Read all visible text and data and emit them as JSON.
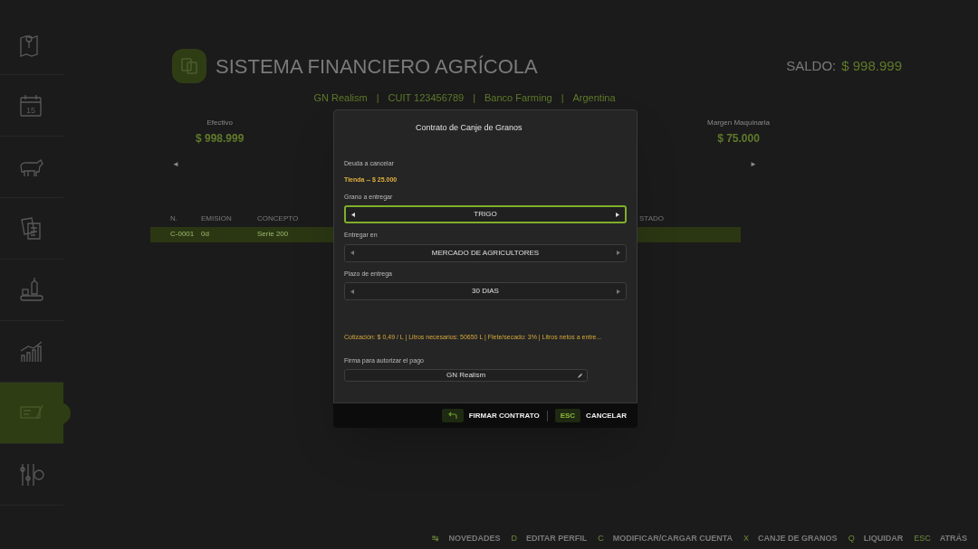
{
  "sidebar": {
    "items": [
      {
        "selected": false
      },
      {
        "text": "15",
        "selected": false
      },
      {
        "selected": false
      },
      {
        "selected": false
      },
      {
        "selected": false
      },
      {
        "selected": false
      },
      {
        "selected": true
      },
      {
        "selected": false
      }
    ]
  },
  "header": {
    "title": "SISTEMA FINANCIERO AGRÍCOLA",
    "balance_label": "SALDO:",
    "balance": "$ 998.999",
    "info": [
      "GN Realism",
      "CUIT 123456789",
      "Banco Farming",
      "Argentina"
    ],
    "separator": "|"
  },
  "stats": [
    {
      "label": "Efectivo",
      "value": "$ 998.999"
    },
    {
      "label": "Margen Maquinaria",
      "value": "$ 75.000"
    }
  ],
  "carousel": {
    "prev": "◄",
    "next": "►"
  },
  "table": {
    "columns": [
      "N.",
      "EMISION",
      "CONCEPTO",
      "STADO"
    ],
    "rows": [
      {
        "cells": [
          "C-0001",
          "0d",
          "Serie 200"
        ],
        "selected": true
      }
    ]
  },
  "dialog": {
    "title": "Contrato de Canje de Granos",
    "debt_label": "Deuda a cancelar",
    "debt": "Tienda -- $ 25.000",
    "selectors": [
      {
        "label": "Grano a entregar",
        "value": "TRIGO",
        "focused": true
      },
      {
        "label": "Entregar en",
        "value": "MERCADO DE AGRICULTORES",
        "focused": false
      },
      {
        "label": "Plazo de entrega",
        "value": "30 DIAS",
        "focused": false
      }
    ],
    "summary": "Cotización: $ 0,49 / L | Litros necesarios: 50650 L | Flete/secado: 3% | Litros netos a entre...",
    "signature_label": "Firma para autorizar el pago",
    "signature": "GN Realism",
    "actions": [
      {
        "label": "FIRMAR CONTRATO"
      },
      {
        "key": "ESC",
        "label": "CANCELAR"
      }
    ]
  },
  "hints": [
    {
      "key": "↹",
      "label": "NOVEDADES"
    },
    {
      "key": "D",
      "label": "EDITAR PERFIL"
    },
    {
      "key": "C",
      "label": "MODIFICAR/CARGAR CUENTA"
    },
    {
      "key": "X",
      "label": "CANJE DE GRANOS"
    },
    {
      "key": "Q",
      "label": "LIQUIDAR"
    },
    {
      "key": "ESC",
      "label": "ATRÁS"
    }
  ]
}
